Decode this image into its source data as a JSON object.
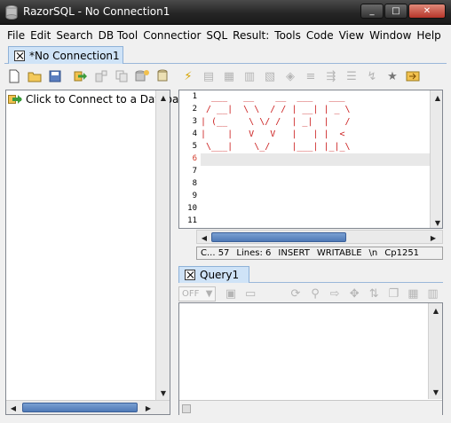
{
  "window": {
    "title": "RazorSQL - No Connection1",
    "controls": [
      "_",
      "□",
      "✕"
    ]
  },
  "menu": [
    "File",
    "Edit",
    "Search",
    "DB Tool",
    "Connectior",
    "SQL",
    "Result:",
    "Tools",
    "Code",
    "View",
    "Window",
    "Help"
  ],
  "connection_tab": {
    "label": "*No Connection1"
  },
  "toolbar": {
    "icons": [
      "new-file-icon",
      "open-folder-icon",
      "save-icon",
      "save-all-icon",
      "new-connection-icon",
      "clipboard-icon",
      "add-database-icon",
      "cylinder-icon",
      "lightning-icon",
      "grid-icon",
      "table-icon",
      "grid-edit-icon",
      "table-edit-icon",
      "tag-icon",
      "stack-icon",
      "format-icon",
      "list-icon",
      "wrap-icon",
      "star-icon",
      "export-icon"
    ]
  },
  "tree": {
    "item_label": "Click to Connect to a Database"
  },
  "editor": {
    "line_numbers": [
      "1",
      "2",
      "3",
      "4",
      "5",
      "6",
      "7",
      "8",
      "9",
      "10",
      "11"
    ],
    "current_line": "6",
    "code_lines": [
      "  ___   __    __  ___   ___",
      " / __|  \\ \\  / / | __| | _ \\",
      "| (__    \\ \\/ /  | _|  |   /",
      "|    |   V   V   |   | |  <",
      " \\___|    \\_/    |___| |_|_\\"
    ]
  },
  "status": {
    "position": "C... 57",
    "lines": "Lines: 6",
    "mode": "INSERT",
    "access": "WRITABLE",
    "newline": "\\n",
    "encoding": "Cp1251"
  },
  "query_tab": {
    "label": "Query1"
  },
  "query_toolbar": {
    "off_label": "OFF"
  }
}
